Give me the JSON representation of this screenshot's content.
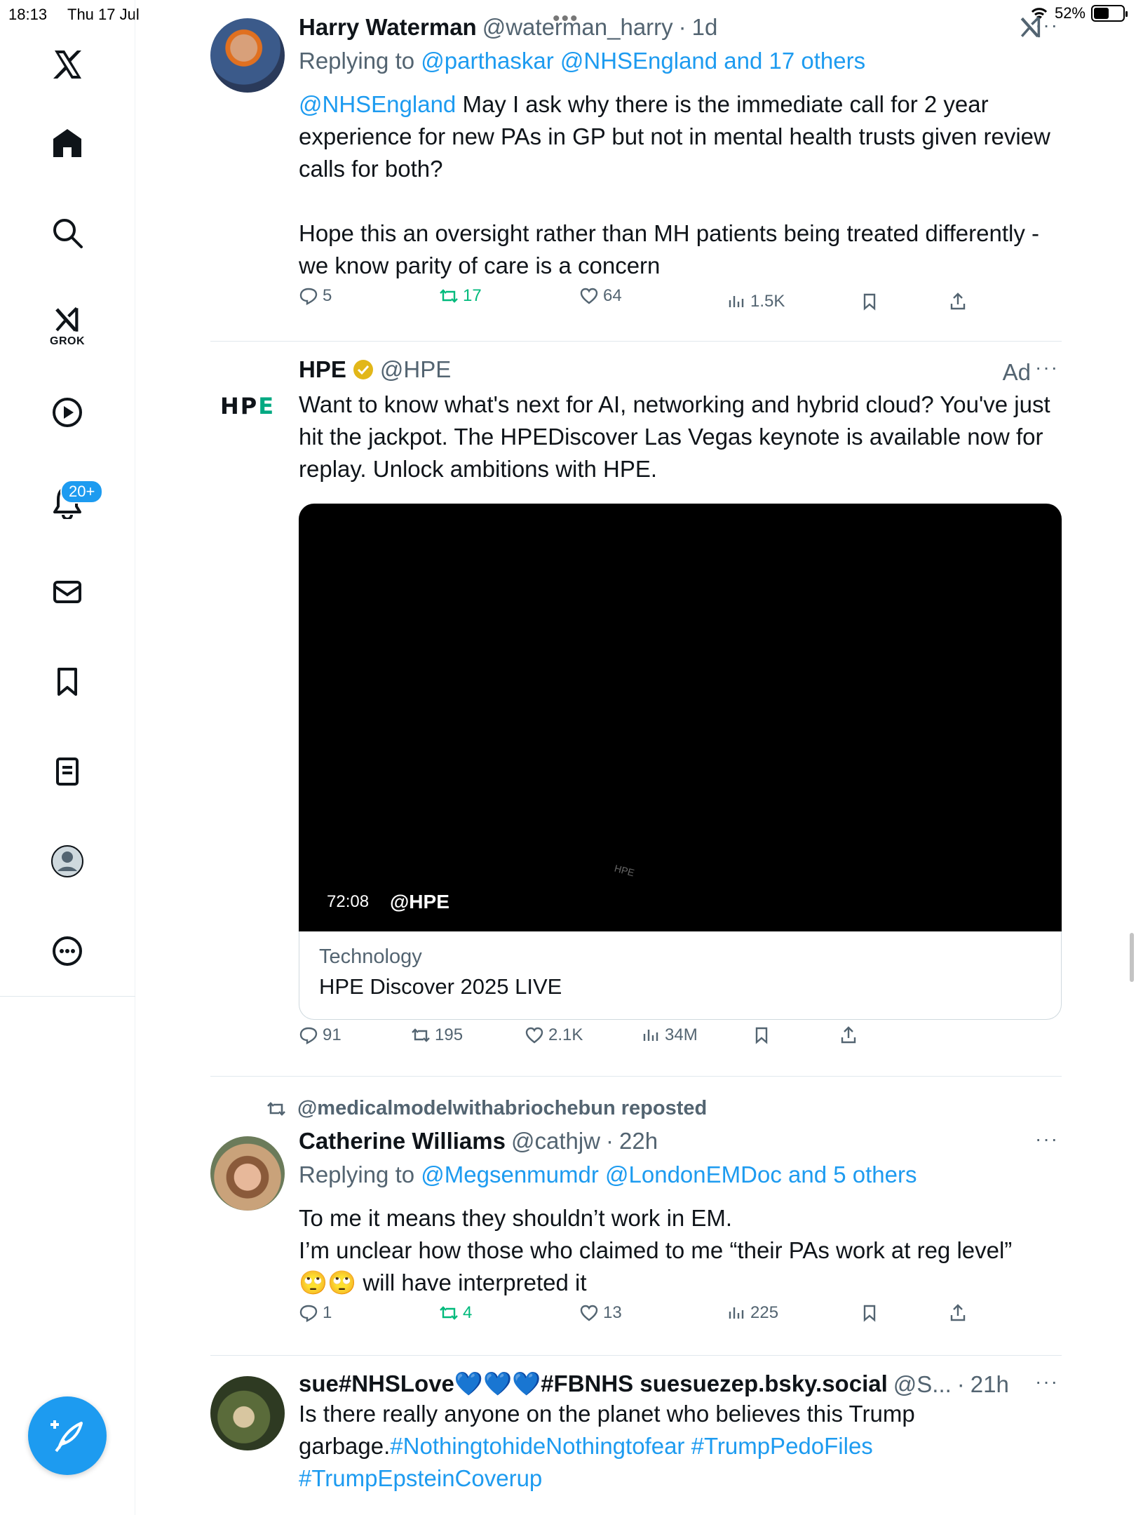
{
  "status_bar": {
    "time": "18:13",
    "date": "Thu 17 Jul",
    "battery": "52%",
    "battery_level": 0.52
  },
  "sidebar": {
    "items": [
      {
        "name": "x-logo"
      },
      {
        "name": "home"
      },
      {
        "name": "search"
      },
      {
        "name": "grok",
        "label": "GROK"
      },
      {
        "name": "video"
      },
      {
        "name": "notifications",
        "badge": "20+"
      },
      {
        "name": "messages"
      },
      {
        "name": "bookmarks"
      },
      {
        "name": "lists"
      },
      {
        "name": "profile"
      },
      {
        "name": "more"
      }
    ],
    "compose_icon": "compose-icon"
  },
  "tweets": [
    {
      "name": "Harry Waterman",
      "handle": "@waterman_harry",
      "time": "1d",
      "replying_prefix": "Replying to",
      "replying_to": "@parthaskar @NHSEngland and 17 others",
      "mention": "@NHSEngland",
      "text1": " May I ask why there is the immediate call for 2 year experience for new PAs in GP but not in mental health trusts given review calls for both?",
      "text2": "Hope this an oversight rather than MH patients being treated differently - we know parity of care is a concern",
      "replies": "5",
      "reposts": "17",
      "likes": "64",
      "views": "1.5K"
    },
    {
      "name": "HPE",
      "handle": "@HPE",
      "ad": "Ad",
      "logo_text": "HPE",
      "text": "Want to know what's next for AI, networking and hybrid cloud? You've just hit the jackpot. The HPEDiscover Las Vegas keynote is available now for replay. Unlock ambitions with HPE.",
      "video_time": "72:08",
      "video_handle": "@HPE",
      "card_category": "Technology",
      "card_title": "HPE Discover 2025 LIVE",
      "replies": "91",
      "reposts": "195",
      "likes": "2.1K",
      "views": "34M"
    },
    {
      "repost_by": "@medicalmodelwithabriochebun reposted",
      "name": "Catherine Williams",
      "handle": "@cathjw",
      "time": "22h",
      "replying_prefix": "Replying to",
      "replying_to": "@Megsenmumdr @LondonEMDoc and 5 others",
      "text1": "To me it means they shouldn’t work in EM.",
      "text2": "I’m unclear how those who claimed to me “their PAs work at reg level”",
      "text3": "🙄🙄 will have interpreted it",
      "replies": "1",
      "reposts": "4",
      "likes": "13",
      "views": "225"
    },
    {
      "name": "sue#NHSLove💙💙💙#FBNHS suesuezep.bsky.social",
      "handle": "@S...",
      "time": "21h",
      "text": "Is there really anyone on the planet who believes this Trump garbage.",
      "hashtags": "#NothingtohideNothingtofear #TrumpPedoFiles",
      "hashtag3": "#TrumpEpsteinCoverup"
    }
  ]
}
